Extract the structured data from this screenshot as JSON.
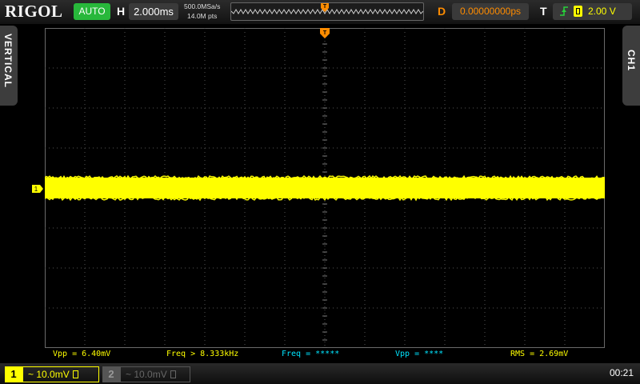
{
  "header": {
    "brand": "RIGOL",
    "run_mode": "AUTO",
    "horizontal_label": "H",
    "timebase": "2.000ms",
    "sample_rate": "500.0MSa/s",
    "memory_depth": "14.0M pts",
    "delay_label": "D",
    "delay": "0.00000000ps",
    "trigger_label": "T",
    "trigger_level": "2.00 V"
  },
  "side_tabs": {
    "left": "VERTICAL",
    "right": "CH1"
  },
  "channel_marker": "1",
  "measurements": [
    {
      "text": "Vpp = 6.40mV",
      "color": "#ffff00"
    },
    {
      "text": "Freq > 8.333kHz",
      "color": "#ffff00"
    },
    {
      "text": "Freq = *****",
      "color": "#00e5ff"
    },
    {
      "text": "Vpp = ****",
      "color": "#00e5ff"
    },
    {
      "text": "RMS = 2.69mV",
      "color": "#ffff00"
    }
  ],
  "footer": {
    "ch1_number": "1",
    "ch1_scale": "~ 10.0mV",
    "ch2_number": "2",
    "ch2_scale": "~ 10.0mV",
    "time": "00:21"
  },
  "colors": {
    "ch1": "#ffff00",
    "ch2": "#00e5ff",
    "trigger": "#ff8c00",
    "auto_mode": "#28b83b"
  },
  "icons": [
    "lock-icon",
    "trigger-rising-edge-icon",
    "trigger-source-icon",
    "trigger-position-marker-icon",
    "channel-offset-marker-icon"
  ]
}
